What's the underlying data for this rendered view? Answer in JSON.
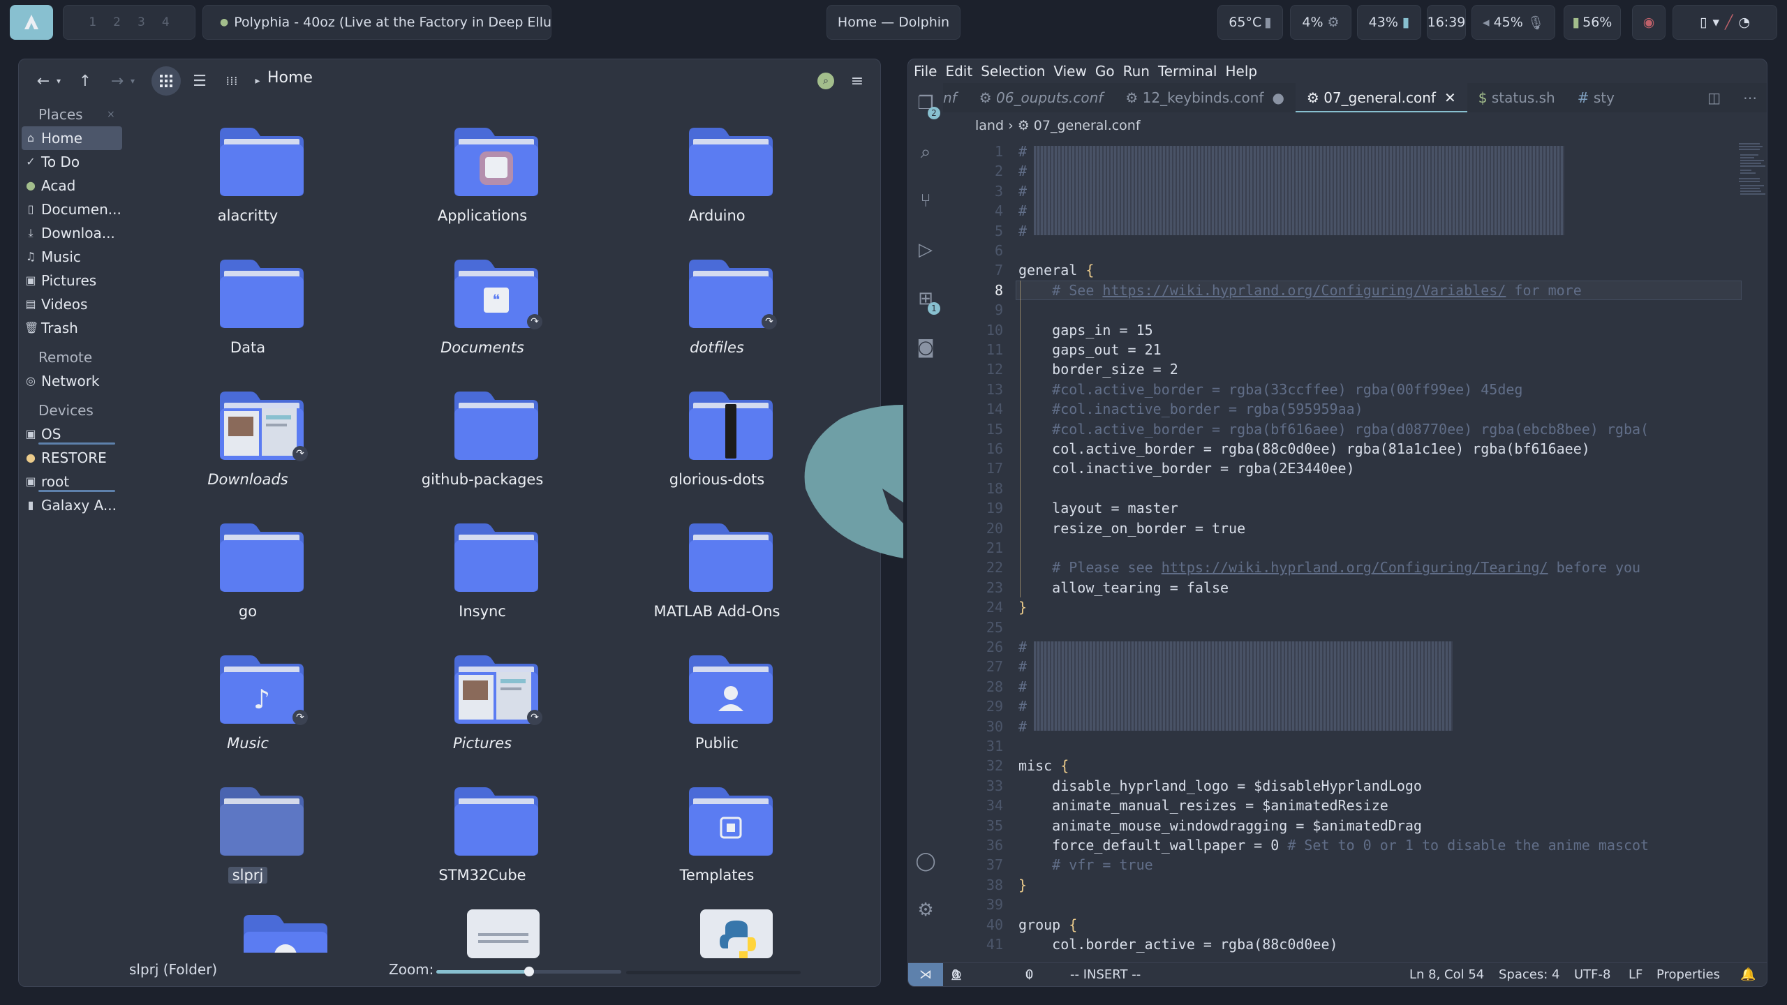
{
  "topbar": {
    "workspaces": [
      "1",
      "2",
      "3",
      "4"
    ],
    "media_title": "Polyphia - 40oz (Live at the Factory in Deep Ellu...",
    "window_title": "Home — Dolphin",
    "temp": "65°C",
    "cpu": "4%",
    "ram": "43%",
    "time": "16:39",
    "volume": "45%",
    "battery": "56%"
  },
  "dolphin": {
    "breadcrumb": "Home",
    "places_header": "Places",
    "places": [
      {
        "label": "Home",
        "icon": "home-icon"
      },
      {
        "label": "To Do",
        "icon": "check-icon"
      },
      {
        "label": "Acad",
        "icon": "dot-icon"
      },
      {
        "label": "Documen...",
        "icon": "document-icon"
      },
      {
        "label": "Downloa...",
        "icon": "download-icon"
      },
      {
        "label": "Music",
        "icon": "music-icon"
      },
      {
        "label": "Pictures",
        "icon": "picture-icon"
      },
      {
        "label": "Videos",
        "icon": "video-icon"
      },
      {
        "label": "Trash",
        "icon": "trash-icon"
      }
    ],
    "remote_header": "Remote",
    "remote": [
      {
        "label": "Network",
        "icon": "network-icon"
      }
    ],
    "devices_header": "Devices",
    "devices": [
      {
        "label": "OS",
        "icon": "drive-icon"
      },
      {
        "label": "RESTORE",
        "icon": "dot-icon"
      },
      {
        "label": "root",
        "icon": "drive-icon"
      },
      {
        "label": "Galaxy A...",
        "icon": "phone-icon"
      }
    ],
    "folders": [
      {
        "label": "alacritty",
        "italic": false
      },
      {
        "label": "Applications",
        "italic": false
      },
      {
        "label": "Arduino",
        "italic": false
      },
      {
        "label": "Data",
        "italic": false
      },
      {
        "label": "Documents",
        "italic": true
      },
      {
        "label": "dotfiles",
        "italic": true
      },
      {
        "label": "Downloads",
        "italic": true
      },
      {
        "label": "github-packages",
        "italic": false
      },
      {
        "label": "glorious-dots",
        "italic": false
      },
      {
        "label": "go",
        "italic": false
      },
      {
        "label": "Insync",
        "italic": false
      },
      {
        "label": "MATLAB Add-Ons",
        "italic": false
      },
      {
        "label": "Music",
        "italic": true
      },
      {
        "label": "Pictures",
        "italic": true
      },
      {
        "label": "Public",
        "italic": false
      },
      {
        "label": "slprj",
        "italic": false
      },
      {
        "label": "STM32Cube",
        "italic": false
      },
      {
        "label": "Templates",
        "italic": false
      }
    ],
    "status_text": "slprj (Folder)",
    "zoom_label": "Zoom:",
    "zoom_level": 0.5
  },
  "vscode": {
    "menu": [
      "File",
      "Edit",
      "Selection",
      "View",
      "Go",
      "Run",
      "Terminal",
      "Help"
    ],
    "tabs": [
      {
        "label": "nf",
        "icon": ""
      },
      {
        "label": "06_ouputs.conf",
        "icon": "gear-icon"
      },
      {
        "label": "12_keybinds.conf",
        "icon": "gear-icon"
      },
      {
        "label": "07_general.conf",
        "icon": "gear-icon"
      },
      {
        "label": "status.sh",
        "icon": "dollar-icon"
      },
      {
        "label": "sty",
        "icon": "hash-icon"
      }
    ],
    "breadcrumb": [
      "land",
      "07_general.conf"
    ],
    "explorer_badge": "2",
    "extensions_badge": "1",
    "code_lines": [
      {
        "n": "1",
        "t": "#"
      },
      {
        "n": "2",
        "t": "#"
      },
      {
        "n": "3",
        "t": "#"
      },
      {
        "n": "4",
        "t": "#"
      },
      {
        "n": "5",
        "t": "#"
      },
      {
        "n": "6",
        "t": ""
      },
      {
        "n": "7",
        "t": "general {"
      },
      {
        "n": "8",
        "t": "    # See https://wiki.hyprland.org/Configuring/Variables/ for more"
      },
      {
        "n": "9",
        "t": ""
      },
      {
        "n": "10",
        "t": "    gaps_in = 15"
      },
      {
        "n": "11",
        "t": "    gaps_out = 21"
      },
      {
        "n": "12",
        "t": "    border_size = 2"
      },
      {
        "n": "13",
        "t": "    #col.active_border = rgba(33ccffee) rgba(00ff99ee) 45deg"
      },
      {
        "n": "14",
        "t": "    #col.inactive_border = rgba(595959aa)"
      },
      {
        "n": "15",
        "t": "    #col.active_border = rgba(bf616aee) rgba(d08770ee) rgba(ebcb8bee) rgba("
      },
      {
        "n": "16",
        "t": "    col.active_border = rgba(88c0d0ee) rgba(81a1c1ee) rgba(bf616aee)"
      },
      {
        "n": "17",
        "t": "    col.inactive_border = rgba(2E3440ee)"
      },
      {
        "n": "18",
        "t": ""
      },
      {
        "n": "19",
        "t": "    layout = master"
      },
      {
        "n": "20",
        "t": "    resize_on_border = true"
      },
      {
        "n": "21",
        "t": ""
      },
      {
        "n": "22",
        "t": "    # Please see https://wiki.hyprland.org/Configuring/Tearing/ before you"
      },
      {
        "n": "23",
        "t": "    allow_tearing = false"
      },
      {
        "n": "24",
        "t": "}"
      },
      {
        "n": "25",
        "t": ""
      },
      {
        "n": "26",
        "t": "#"
      },
      {
        "n": "27",
        "t": "#"
      },
      {
        "n": "28",
        "t": "#"
      },
      {
        "n": "29",
        "t": "#"
      },
      {
        "n": "30",
        "t": "#"
      },
      {
        "n": "31",
        "t": ""
      },
      {
        "n": "32",
        "t": "misc {"
      },
      {
        "n": "33",
        "t": "    disable_hyprland_logo = $disableHyprlandLogo"
      },
      {
        "n": "34",
        "t": "    animate_manual_resizes = $animatedResize"
      },
      {
        "n": "35",
        "t": "    animate_mouse_windowdragging = $animatedDrag"
      },
      {
        "n": "36",
        "t": "    force_default_wallpaper = 0 # Set to 0 or 1 to disable the anime mascot"
      },
      {
        "n": "37",
        "t": "    # vfr = true"
      },
      {
        "n": "38",
        "t": "}"
      },
      {
        "n": "39",
        "t": ""
      },
      {
        "n": "40",
        "t": "group {"
      },
      {
        "n": "41",
        "t": "    col.border_active = rgba(88c0d0ee)"
      }
    ],
    "current_line": "8",
    "status": {
      "errors": "0",
      "warnings": "0",
      "ports": "0",
      "mode": "-- INSERT --",
      "position": "Ln 8, Col 54",
      "spaces": "Spaces: 4",
      "encoding": "UTF-8",
      "eol": "LF",
      "properties": "Properties"
    }
  },
  "colors": {
    "accent": "#88c0d0",
    "folder": "#5e7ef0",
    "bg": "#2e3440"
  }
}
